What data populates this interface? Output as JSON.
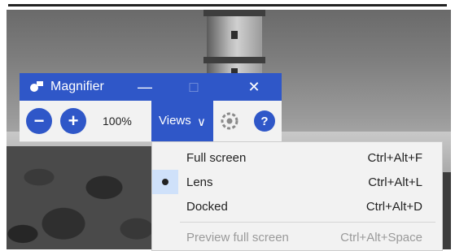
{
  "window": {
    "title": "Magnifier",
    "icons": {
      "app": "magnifier-app-icon",
      "minimize": "minimize-icon",
      "maximize": "maximize-icon",
      "close": "close-icon"
    },
    "controls": {
      "minimize_glyph": "—",
      "maximize_glyph": "□",
      "close_glyph": "✕"
    }
  },
  "toolbar": {
    "zoom_out_glyph": "−",
    "zoom_in_glyph": "+",
    "zoom_level": "100%",
    "views_label": "Views",
    "views_chevron": "∨",
    "settings_icon": "gear-icon",
    "help_glyph": "?"
  },
  "views_menu": {
    "items": [
      {
        "label": "Full screen",
        "shortcut": "Ctrl+Alt+F",
        "selected": false,
        "enabled": true
      },
      {
        "label": "Lens",
        "shortcut": "Ctrl+Alt+L",
        "selected": true,
        "enabled": true
      },
      {
        "label": "Docked",
        "shortcut": "Ctrl+Alt+D",
        "selected": false,
        "enabled": true
      },
      {
        "label": "Preview full screen",
        "shortcut": "Ctrl+Alt+Space",
        "selected": false,
        "enabled": false
      }
    ]
  },
  "colors": {
    "accent": "#2f57c8",
    "menu_bg": "#f2f2f2",
    "selected_bg": "#cfe1fa",
    "disabled_text": "#9a9a9a"
  }
}
